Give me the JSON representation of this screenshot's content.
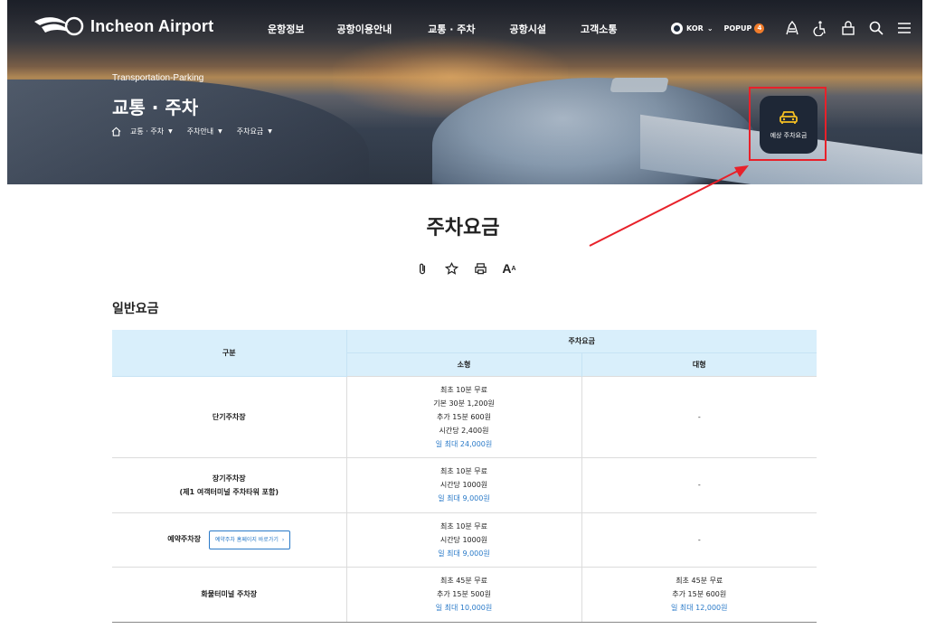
{
  "header": {
    "logo_text": "Incheon Airport",
    "nav": [
      "운항정보",
      "공항이용안내",
      "교통 · 주차",
      "공항시설",
      "고객소통"
    ],
    "language": "KOR",
    "popup_label": "POPUP",
    "popup_count": "4",
    "icons": [
      "sitemap-icon",
      "accessibility-icon",
      "lock-icon",
      "search-icon",
      "menu-icon"
    ]
  },
  "hero": {
    "subtitle": "Transportation-Parking",
    "title": "교통 · 주차",
    "breadcrumb": [
      "교통 · 주차",
      "주차안내",
      "주차요금"
    ],
    "fee_button_label": "예상 주차요금"
  },
  "page": {
    "title": "주차요금",
    "tools": [
      "attach-icon",
      "share-icon",
      "print-icon",
      "font-size-icon"
    ],
    "font_tool_big": "A",
    "font_tool_small": "A",
    "section_title": "일반요금"
  },
  "table": {
    "header_category": "구분",
    "header_group": "주차요금",
    "header_small": "소형",
    "header_large": "대형",
    "rows": [
      {
        "category": "단기주차장",
        "small": [
          "최초 10분 무료",
          "기본 30분 1,200원",
          "추가 15분 600원",
          "시간당 2,400원"
        ],
        "small_max": "일 최대 24,000원",
        "large": "-"
      },
      {
        "category": "장기주차장",
        "category_sub": "(제1 여객터미널 주차타워 포함)",
        "small": [
          "최초 10분 무료",
          "시간당 1000원"
        ],
        "small_max": "일 최대 9,000원",
        "large": "-"
      },
      {
        "category": "예약주차장",
        "link_label": "예약주차 홈페이지 바로가기",
        "small": [
          "최초 10분 무료",
          "시간당 1000원"
        ],
        "small_max": "일 최대 9,000원",
        "large": "-"
      },
      {
        "category": "화물터미널 주차장",
        "small": [
          "최초 45분 무료",
          "추가 15분 500원"
        ],
        "small_max": "일 최대 10,000원",
        "large_lines": [
          "최초 45분 무료",
          "추가 15분 600원"
        ],
        "large_max": "일 최대 12,000원"
      }
    ]
  },
  "colors": {
    "header_bg": "#d9effb",
    "max_fee": "#2a7ac8",
    "highlight": "#e8212a",
    "fee_button_bg": "#1e2736",
    "popup_badge": "#f07c2b"
  }
}
